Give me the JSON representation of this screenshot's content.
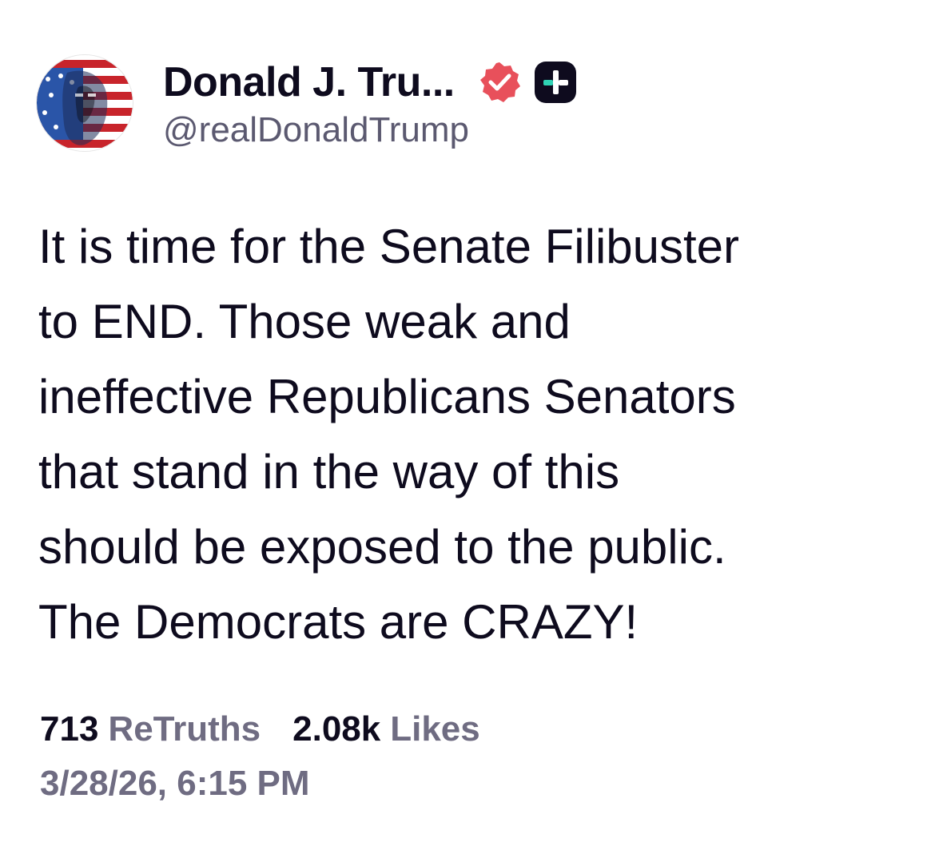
{
  "author": {
    "display_name": "Donald J. Tru...",
    "handle": "@realDonaldTrump",
    "avatar_icon": "flag-portrait-avatar",
    "verified_icon": "verified-badge-icon",
    "plus_icon": "plus-badge-icon"
  },
  "post": {
    "lines": [
      "It is time for the Senate Filibuster",
      "to END. Those weak and",
      "ineffective Republicans Senators",
      "that stand in the way of this",
      "should be exposed to the public.",
      "The Democrats are CRAZY!"
    ]
  },
  "stats": {
    "retruths_count": "713",
    "retruths_label": "ReTruths",
    "likes_count": "2.08k",
    "likes_label": "Likes"
  },
  "timestamp": "3/28/26, 6:15 PM",
  "colors": {
    "text": "#0e0b1e",
    "muted": "#6f6c82",
    "verified": "#e8505b",
    "plus_badge": "#0e0b1e",
    "plus_accent": "#2fd3b4"
  }
}
